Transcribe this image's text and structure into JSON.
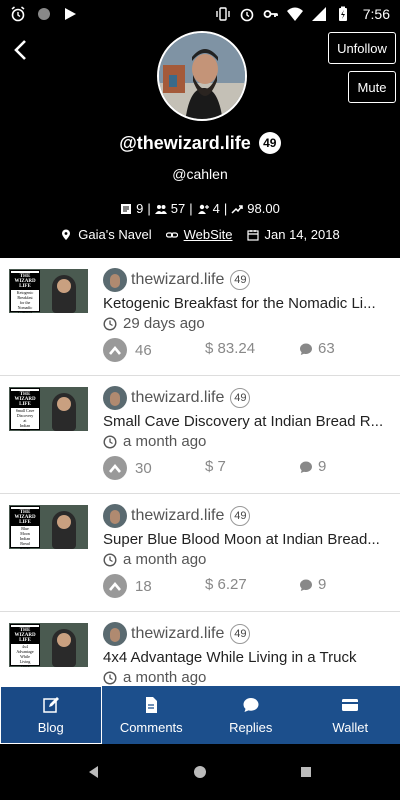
{
  "status_bar": {
    "time": "7:56"
  },
  "profile": {
    "display_name": "@thewizard.life",
    "reputation": "49",
    "handle": "@cahlen",
    "stats": {
      "posts": "9",
      "followers": "57",
      "following": "4",
      "power": "98.00"
    },
    "location": "Gaia's Navel",
    "website_label": "WebSite",
    "joined": "Jan 14, 2018",
    "unfollow_label": "Unfollow",
    "mute_label": "Mute"
  },
  "posts": [
    {
      "author": "thewizard.life",
      "rep": "49",
      "title": "Ketogenic Breakfast for the Nomadic Li...",
      "time": "29 days ago",
      "votes": "46",
      "payout": "$ 83.24",
      "comments": "63",
      "thumb_lines": [
        "Ketogenic",
        "Breakfast",
        "for the",
        "Nomadic",
        "Lifestyle"
      ]
    },
    {
      "author": "thewizard.life",
      "rep": "49",
      "title": "Small Cave Discovery at Indian Bread R...",
      "time": "a month ago",
      "votes": "30",
      "payout": "$ 7",
      "comments": "9",
      "thumb_lines": [
        "Small Cave",
        "Discovery",
        "at",
        "Indian",
        "Bread",
        "Rocks"
      ]
    },
    {
      "author": "thewizard.life",
      "rep": "49",
      "title": "Super Blue Blood Moon at Indian Bread...",
      "time": "a month ago",
      "votes": "18",
      "payout": "$ 6.27",
      "comments": "9",
      "thumb_lines": [
        "Blue",
        "Moon",
        "Indian",
        "Bread",
        "Rocks"
      ]
    },
    {
      "author": "thewizard.life",
      "rep": "49",
      "title": "4x4 Advantage While Living in a Truck",
      "time": "a month ago",
      "votes": "",
      "payout": "",
      "comments": "",
      "thumb_lines": [
        "4x4",
        "Advantage",
        "While",
        "Living",
        "Truck"
      ]
    }
  ],
  "thumb_brand": [
    "THE",
    "WIZARD",
    "LIFE"
  ],
  "nav": {
    "blog": "Blog",
    "comments": "Comments",
    "replies": "Replies",
    "wallet": "Wallet"
  },
  "colors": {
    "nav_bg": "#1c4f8c",
    "header_bg": "#000000",
    "feed_bg": "#ffffff"
  }
}
